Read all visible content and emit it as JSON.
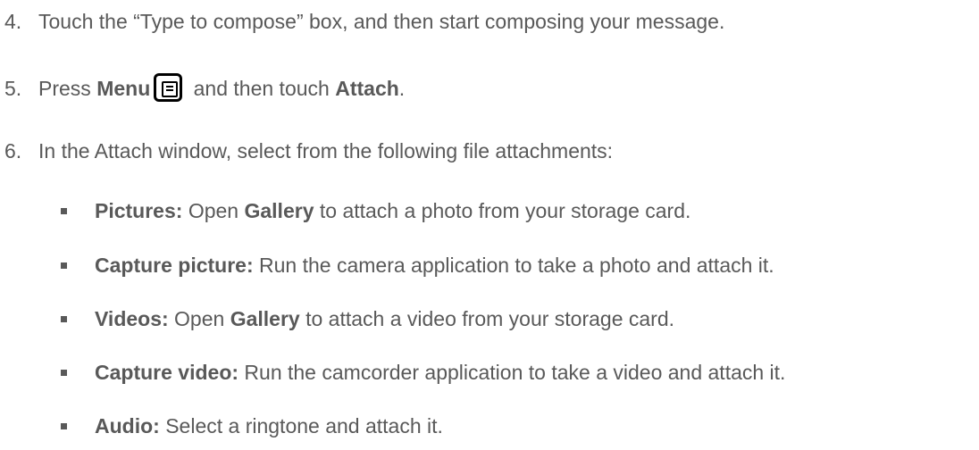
{
  "steps": [
    {
      "number": "4.",
      "text": "Touch the “Type to compose” box, and then start composing your message."
    },
    {
      "number": "5.",
      "press": "Press ",
      "menu": "Menu",
      "menu_icon": "menu-key-icon",
      "middle": " and then touch ",
      "attach": "Attach",
      "end": "."
    },
    {
      "number": "6.",
      "text": "In the Attach window, select from the following file attachments:"
    }
  ],
  "bullets": [
    {
      "label": "Pictures:",
      "parts": [
        " Open ",
        "Gallery",
        " to attach a photo from your storage card."
      ]
    },
    {
      "label": "Capture picture:",
      "text": " Run the camera application to take a photo and attach it."
    },
    {
      "label": "Videos:",
      "parts": [
        " Open ",
        "Gallery",
        " to attach a video from your storage card."
      ]
    },
    {
      "label": "Capture video:",
      "text": " Run the camcorder application to take a video and attach it."
    },
    {
      "label": "Audio:",
      "text": " Select a ringtone and attach it."
    }
  ],
  "colors": {
    "text": "#595959",
    "icon": "#000000",
    "background": "#ffffff"
  }
}
